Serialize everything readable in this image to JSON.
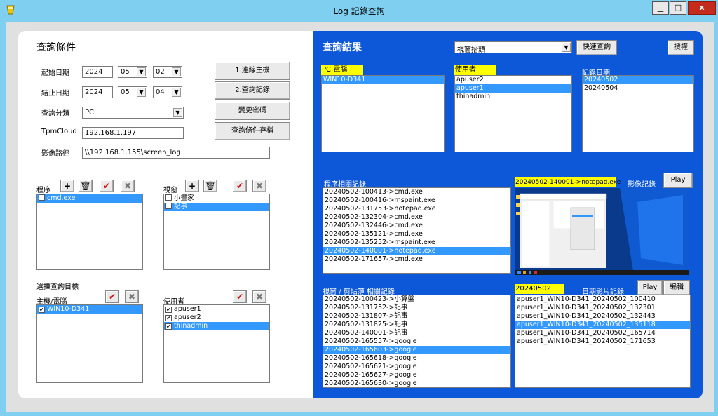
{
  "window": {
    "title": "Log 記錄查詢",
    "min": "▁",
    "max": "□",
    "close": "x"
  },
  "query": {
    "heading": "查詢條件",
    "start_label": "起始日期",
    "start_year": "2024",
    "start_month": "05",
    "start_day": "02",
    "end_label": "結止日期",
    "end_year": "2024",
    "end_month": "05",
    "end_day": "04",
    "category_label": "查詢分類",
    "category_value": "PC",
    "tpm_label": "TpmCloud",
    "tpm_value": "192.168.1.197",
    "path_label": "影像路徑",
    "path_value": "\\\\192.168.1.155\\screen_log",
    "btn_connect": "1.連線主機",
    "btn_query": "2.查詢記錄",
    "btn_password": "變更密碼",
    "btn_save": "查詢條件存檔"
  },
  "filters": {
    "program_label": "程序",
    "program_items": [
      {
        "text": "cmd.exe",
        "checked": false,
        "selected": true
      }
    ],
    "window_label": "視窗",
    "window_items": [
      {
        "text": "小畫家",
        "checked": false,
        "selected": false
      },
      {
        "text": "記事",
        "checked": false,
        "selected": true
      }
    ],
    "target_heading": "選擇查詢目標",
    "host_label": "主機/電腦",
    "host_items": [
      {
        "text": "WIN10-D341",
        "checked": true,
        "selected": true
      }
    ],
    "user_label": "使用者",
    "user_items": [
      {
        "text": "apuser1",
        "checked": true,
        "selected": false
      },
      {
        "text": "apuser2",
        "checked": true,
        "selected": false
      },
      {
        "text": "thinadmin",
        "checked": true,
        "selected": true
      }
    ]
  },
  "results": {
    "heading": "查詢結果",
    "view_select": "視窗抬頭",
    "btn_quick": "快速查詢",
    "btn_auth": "授權",
    "pc_label": "PC 電腦",
    "pc_items": [
      {
        "text": "WIN10-D341",
        "selected": true
      }
    ],
    "user_label": "使用者",
    "user_items": [
      {
        "text": "apuser2",
        "selected": false
      },
      {
        "text": "apuser1",
        "selected": true
      },
      {
        "text": "thinadmin",
        "selected": false
      }
    ],
    "date_label": "記錄日期",
    "date_items": [
      {
        "text": "20240502",
        "selected": true
      },
      {
        "text": "20240504",
        "selected": false
      }
    ],
    "program_log_label": "程序相關記錄",
    "program_log": [
      {
        "text": "20240502-100413->cmd.exe",
        "selected": false
      },
      {
        "text": "20240502-100416->mspaint.exe",
        "selected": false
      },
      {
        "text": "20240502-131753->notepad.exe",
        "selected": false
      },
      {
        "text": "20240502-132304->cmd.exe",
        "selected": false
      },
      {
        "text": "20240502-132446->cmd.exe",
        "selected": false
      },
      {
        "text": "20240502-135121->cmd.exe",
        "selected": false
      },
      {
        "text": "20240502-135252->mspaint.exe",
        "selected": false
      },
      {
        "text": "20240502-140001->notepad.exe",
        "selected": true
      },
      {
        "text": "20240502-171657->cmd.exe",
        "selected": false
      }
    ],
    "current_record": "20240502-140001->notepad.exe",
    "image_record_label": "影像記錄",
    "btn_play1": "Play",
    "clipboard_label": "視窗 / 剪貼簿 相關記錄",
    "clipboard_log": [
      {
        "text": "20240502-100423->小算盤",
        "selected": false
      },
      {
        "text": "20240502-131752->記事",
        "selected": false
      },
      {
        "text": "20240502-131807->記事",
        "selected": false
      },
      {
        "text": "20240502-131825->記事",
        "selected": false
      },
      {
        "text": "20240502-140001->記事",
        "selected": false
      },
      {
        "text": "20240502-165557->google",
        "selected": false
      },
      {
        "text": "20240502-165603->google",
        "selected": true
      },
      {
        "text": "20240502-165618->google",
        "selected": false
      },
      {
        "text": "20240502-165621->google",
        "selected": false
      },
      {
        "text": "20240502-165627->google",
        "selected": false
      },
      {
        "text": "20240502-165630->google",
        "selected": false
      }
    ],
    "video_date": "20240502",
    "video_label": "日期影片記錄",
    "btn_play2": "Play",
    "btn_edit": "編輯",
    "video_list": [
      {
        "text": "apuser1_WIN10-D341_20240502_100410",
        "selected": false
      },
      {
        "text": "apuser1_WIN10-D341_20240502_132301",
        "selected": false
      },
      {
        "text": "apuser1_WIN10-D341_20240502_132443",
        "selected": false
      },
      {
        "text": "apuser1_WIN10-D341_20240502_135118",
        "selected": true
      },
      {
        "text": "apuser1_WIN10-D341_20240502_165714",
        "selected": false
      },
      {
        "text": "apuser1_WIN10-D341_20240502_171653",
        "selected": false
      }
    ]
  }
}
